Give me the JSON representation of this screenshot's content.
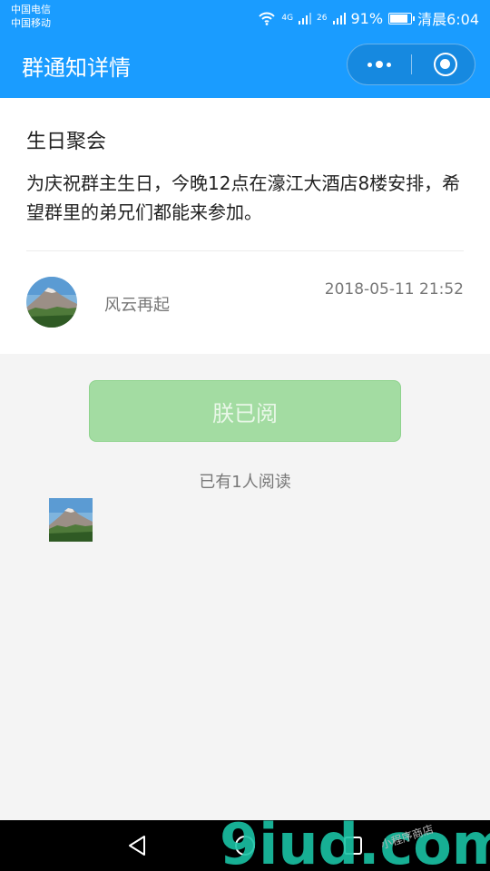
{
  "status_bar": {
    "carrier_1": "中国电信",
    "carrier_2": "中国移动",
    "network_1": "4G",
    "network_2": "26",
    "battery": "91%",
    "time": "清晨6:04"
  },
  "navbar": {
    "title": "群通知详情",
    "more_icon": "more-dots-icon",
    "close_icon": "target-close-icon",
    "color": "#1a9cff"
  },
  "notice": {
    "title": "生日聚会",
    "content": "为庆祝群主生日，今晚12点在濠江大酒店8楼安排，希望群里的弟兄们都能来参加。",
    "author": "风云再起",
    "datetime": "2018-05-11 21:52"
  },
  "read_button": {
    "label": "朕已阅",
    "color": "#a3dca2"
  },
  "readers": {
    "count_text": "已有1人阅读"
  },
  "watermark": {
    "text": "9iud.com",
    "small_text": "小程序商店"
  },
  "bottom_nav": {
    "back_icon": "triangle-back-icon",
    "home_icon": "circle-home-icon",
    "recent_icon": "square-recent-icon"
  }
}
